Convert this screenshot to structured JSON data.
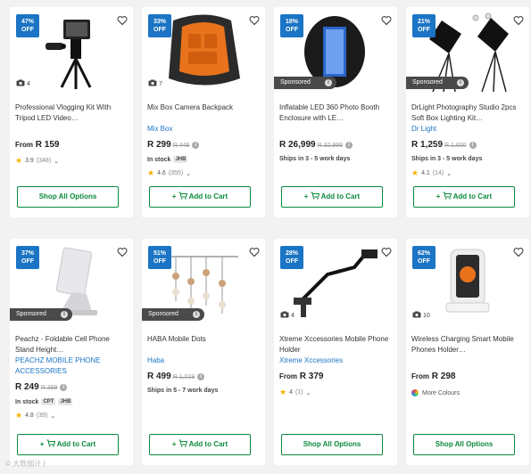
{
  "products": [
    {
      "discount": "47%\nOFF",
      "photos": "4",
      "sponsored": false,
      "title": "Professional Vlogging Kit With Tripod LED Video…",
      "brand": "",
      "price_prefix": "From",
      "price": "R 159",
      "old_price": "",
      "stock": "",
      "stock_tags": [],
      "ships": "",
      "rating": "3.9",
      "reviews": "(348)",
      "colours": "",
      "button": "Shop All Options",
      "button_type": "shop",
      "icon": "vlogging-kit-image"
    },
    {
      "discount": "33%\nOFF",
      "photos": "7",
      "sponsored": false,
      "title": "Mix Box Camera Backpack",
      "brand": "Mix Box",
      "price_prefix": "",
      "price": "R 299",
      "old_price": "R 449",
      "stock": "In stock",
      "stock_tags": [
        "JHB"
      ],
      "ships": "",
      "rating": "4.6",
      "reviews": "(355)",
      "colours": "",
      "button": "Add to Cart",
      "button_type": "cart",
      "icon": "backpack-image"
    },
    {
      "discount": "18%\nOFF",
      "photos": "",
      "sponsored": true,
      "title": "Inflatable LED 360 Photo Booth Enclosure with LE…",
      "brand": "",
      "price_prefix": "",
      "price": "R 26,999",
      "old_price": "R 32,999",
      "stock": "",
      "stock_tags": [],
      "ships": "Ships in 3 - 5 work days",
      "rating": "",
      "reviews": "",
      "colours": "",
      "button": "Add to Cart",
      "button_type": "cart",
      "icon": "photo-booth-image"
    },
    {
      "discount": "21%\nOFF",
      "photos": "",
      "sponsored": true,
      "title": "DrLight Photography Studio 2pcs Soft Box Lighting Kit…",
      "brand": "Dr Light",
      "price_prefix": "",
      "price": "R 1,259",
      "old_price": "R 1,600",
      "stock": "",
      "stock_tags": [],
      "ships": "Ships in 3 - 5 work days",
      "rating": "4.1",
      "reviews": "(14)",
      "colours": "",
      "button": "Add to Cart",
      "button_type": "cart",
      "icon": "softbox-image"
    },
    {
      "discount": "37%\nOFF",
      "photos": "",
      "sponsored": true,
      "title": "Peachz - Foldable Cell Phone Stand Height…",
      "brand": "PEACHZ MOBILE PHONE ACCESSORIES",
      "price_prefix": "",
      "price": "R 249",
      "old_price": "R 399",
      "stock": "In stock",
      "stock_tags": [
        "CPT",
        "JHB"
      ],
      "ships": "",
      "rating": "4.8",
      "reviews": "(39)",
      "colours": "",
      "button": "Add to Cart",
      "button_type": "cart",
      "icon": "phone-stand-image"
    },
    {
      "discount": "51%\nOFF",
      "photos": "",
      "sponsored": true,
      "title": "HABA Mobile Dots",
      "brand": "Haba",
      "price_prefix": "",
      "price": "R 499",
      "old_price": "R 1,019",
      "stock": "",
      "stock_tags": [],
      "ships": "Ships in 5 - 7 work days",
      "rating": "",
      "reviews": "",
      "colours": "",
      "button": "Add to Cart",
      "button_type": "cart",
      "icon": "mobile-dots-image"
    },
    {
      "discount": "28%\nOFF",
      "photos": "4",
      "sponsored": false,
      "title": "Xtreme Xccessories Mobile Phone Holder",
      "brand": "Xtreme Xccessories",
      "price_prefix": "From",
      "price": "R 379",
      "old_price": "",
      "stock": "",
      "stock_tags": [],
      "ships": "",
      "rating": "4",
      "reviews": "(1)",
      "colours": "",
      "button": "Shop All Options",
      "button_type": "shop",
      "icon": "phone-holder-image"
    },
    {
      "discount": "62%\nOFF",
      "photos": "10",
      "sponsored": false,
      "title": "Wireless Charging Smart Mobile Phones Holder…",
      "brand": "",
      "price_prefix": "From",
      "price": "R 298",
      "old_price": "",
      "stock": "",
      "stock_tags": [],
      "ships": "",
      "rating": "",
      "reviews": "",
      "colours": "More Colours",
      "button": "Shop All Options",
      "button_type": "shop",
      "icon": "wireless-charger-image"
    }
  ],
  "labels": {
    "sponsored": "Sponsored",
    "watermark": "© 大数据计 Ι"
  },
  "colors": {
    "accent": "#1b74c4",
    "button": "#0b8a3d",
    "star": "#f5b301"
  }
}
